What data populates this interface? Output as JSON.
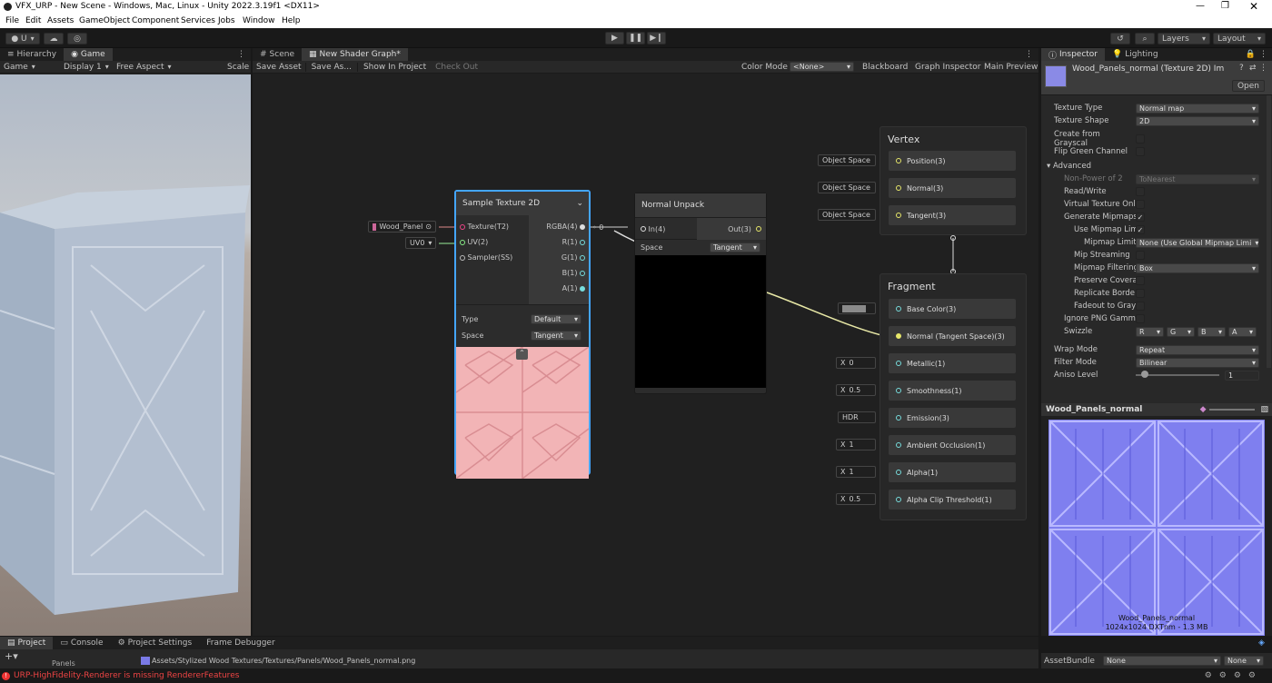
{
  "window": {
    "title": "VFX_URP - New Scene - Windows, Mac, Linux - Unity 2022.3.19f1 <DX11>"
  },
  "menu": [
    "File",
    "Edit",
    "Assets",
    "GameObject",
    "Component",
    "Services",
    "Jobs",
    "Window",
    "Help"
  ],
  "toolbar": {
    "account": "U",
    "layers": "Layers",
    "layout": "Layout"
  },
  "left_panel": {
    "tabs": [
      "Hierarchy",
      "Game"
    ],
    "game_dd": "Game",
    "display": "Display 1",
    "aspect": "Free Aspect",
    "scale": "Scale"
  },
  "center": {
    "tabs": [
      "Scene",
      "New Shader Graph*"
    ],
    "actions": {
      "save": "Save Asset",
      "save_as": "Save As...",
      "show": "Show In Project",
      "checkout": "Check Out"
    },
    "color_mode_label": "Color Mode",
    "color_mode": "<None>",
    "right_actions": [
      "Blackboard",
      "Graph Inspector",
      "Main Preview"
    ]
  },
  "sample_node": {
    "title": "Sample Texture 2D",
    "inputs": [
      "Texture(T2)",
      "UV(2)",
      "Sampler(SS)"
    ],
    "outputs": [
      "RGBA(4)",
      "R(1)",
      "G(1)",
      "B(1)",
      "A(1)"
    ],
    "type_label": "Type",
    "type_value": "Default",
    "space_label": "Space",
    "space_value": "Tangent",
    "texture_chip": "Wood_Panel",
    "uv_chip": "UV0"
  },
  "unpack_node": {
    "title": "Normal Unpack",
    "input": "In(4)",
    "output": "Out(3)",
    "space_label": "Space",
    "space_value": "Tangent",
    "in_value": "0"
  },
  "vertex": {
    "title": "Vertex",
    "slots": [
      {
        "label": "Position(3)",
        "chip": "Object Space"
      },
      {
        "label": "Normal(3)",
        "chip": "Object Space"
      },
      {
        "label": "Tangent(3)",
        "chip": "Object Space"
      }
    ]
  },
  "fragment": {
    "title": "Fragment",
    "slots": [
      {
        "label": "Base Color(3)",
        "chip": "",
        "x": ""
      },
      {
        "label": "Normal (Tangent Space)(3)",
        "chip": "",
        "x": ""
      },
      {
        "label": "Metallic(1)",
        "chip": "0",
        "x": "X"
      },
      {
        "label": "Smoothness(1)",
        "chip": "0.5",
        "x": "X"
      },
      {
        "label": "Emission(3)",
        "chip": "HDR",
        "x": ""
      },
      {
        "label": "Ambient Occlusion(1)",
        "chip": "1",
        "x": "X"
      },
      {
        "label": "Alpha(1)",
        "chip": "1",
        "x": "X"
      },
      {
        "label": "Alpha Clip Threshold(1)",
        "chip": "0.5",
        "x": "X"
      }
    ]
  },
  "inspector": {
    "tabs": [
      "Inspector",
      "Lighting"
    ],
    "asset_title": "Wood_Panels_normal (Texture 2D) Im",
    "open": "Open",
    "texture_type_label": "Texture Type",
    "texture_type": "Normal map",
    "texture_shape_label": "Texture Shape",
    "texture_shape": "2D",
    "create_gray": "Create from Grayscal",
    "flip_green": "Flip Green Channel",
    "advanced": "Advanced",
    "npot_label": "Non-Power of 2",
    "npot": "ToNearest",
    "read_write": "Read/Write",
    "virtual_tex": "Virtual Texture Onl",
    "gen_mip": "Generate Mipmaps",
    "use_mip": "Use Mipmap Lim",
    "mip_limit_label": "Mipmap Limit",
    "mip_limit": "None (Use Global Mipmap Limi",
    "mip_stream": "Mip Streaming",
    "mip_filter_label": "Mipmap Filtering",
    "mip_filter": "Box",
    "preserve": "Preserve Covera",
    "replicate": "Replicate Borde",
    "fadeout": "Fadeout to Gray",
    "ignore_png": "Ignore PNG Gamm",
    "swizzle_label": "Swizzle",
    "swizzle": [
      "R",
      "G",
      "B",
      "A"
    ],
    "wrap_label": "Wrap Mode",
    "wrap": "Repeat",
    "filter_label": "Filter Mode",
    "filter": "Bilinear",
    "aniso_label": "Aniso Level",
    "aniso": "1",
    "preview_title": "Wood_Panels_normal",
    "preview_caption1": "Wood_Panels_normal",
    "preview_caption2": "1024x1024  DXTnm - 1.3 MB",
    "assetbundle_label": "AssetBundle",
    "assetbundle": "None",
    "assetbundle_variant": "None"
  },
  "bottom": {
    "tabs": [
      "Project",
      "Console",
      "Project Settings",
      "Frame Debugger"
    ],
    "path": "Assets/Stylized Wood Textures/Textures/Panels/Wood_Panels_normal.png",
    "folder": "Panels",
    "error": "URP-HighFidelity-Renderer is missing RendererFeatures"
  }
}
